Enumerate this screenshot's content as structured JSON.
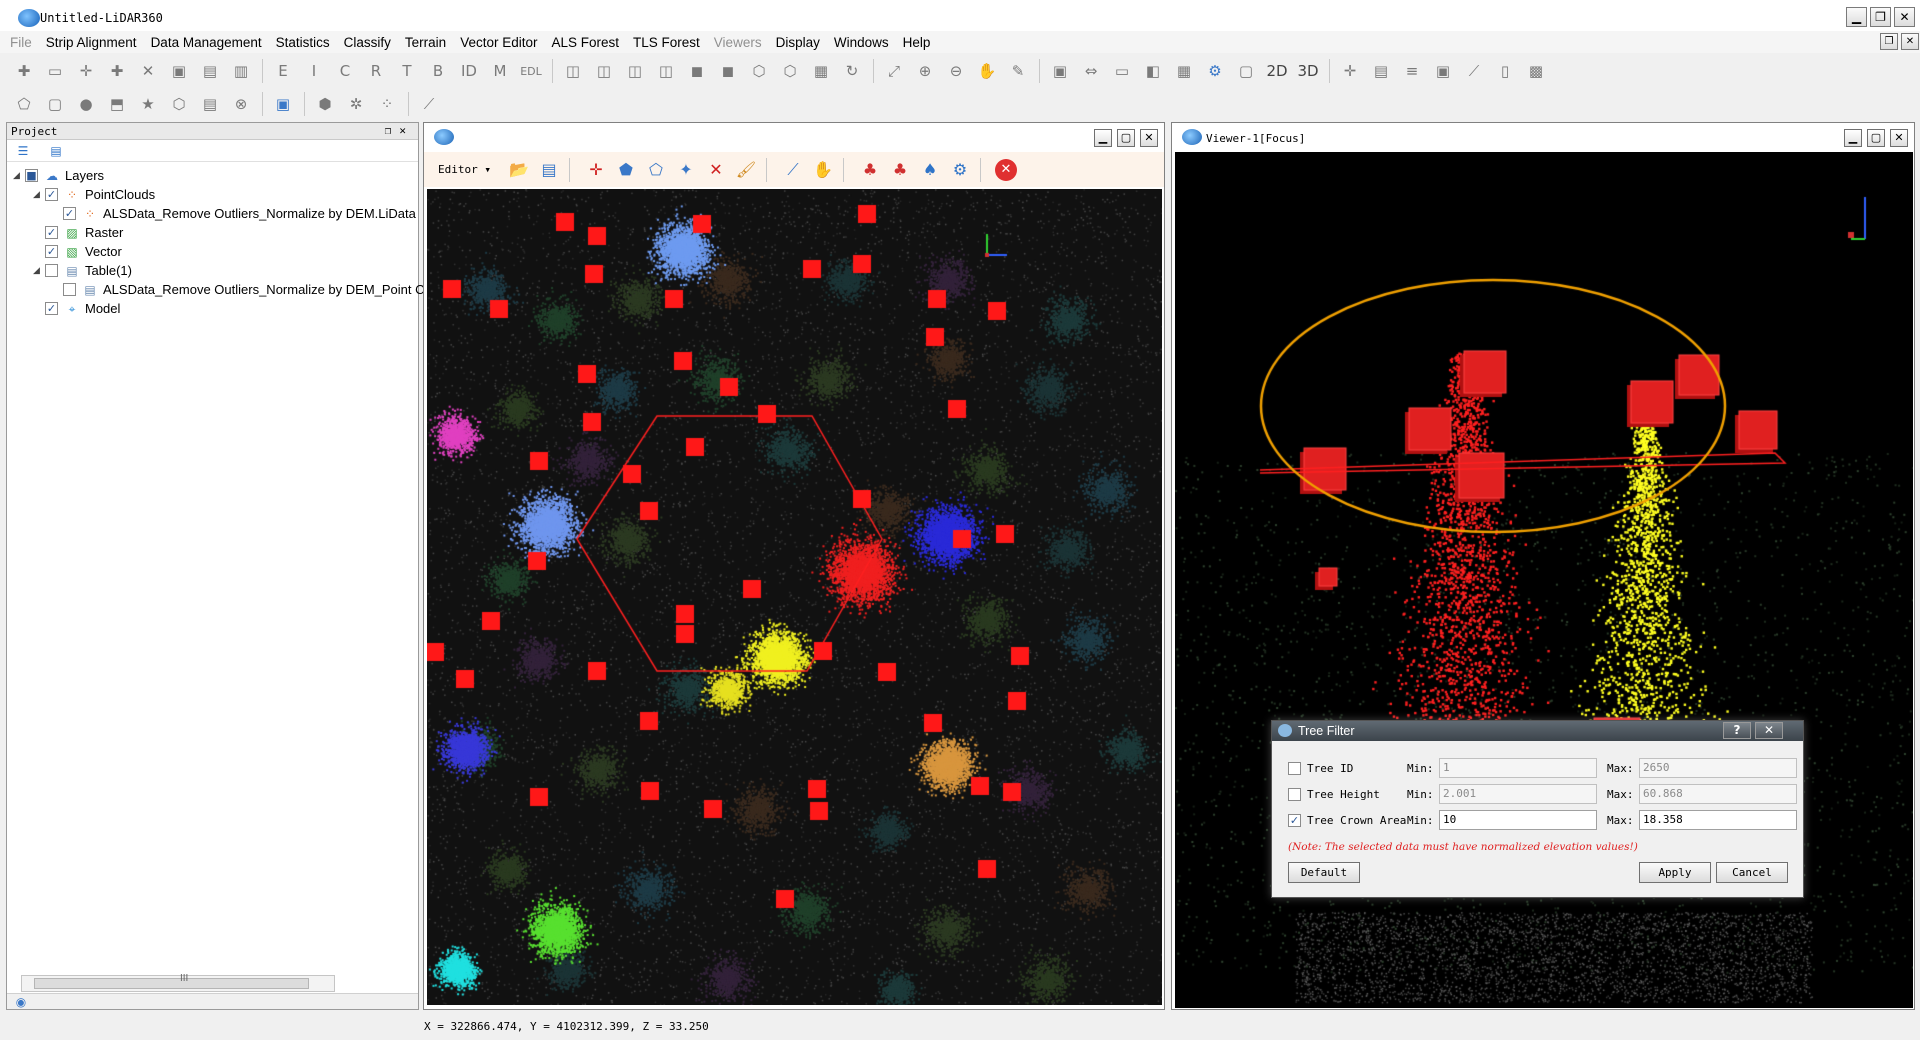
{
  "window": {
    "title": "Untitled-LiDAR360"
  },
  "menu": {
    "items": [
      {
        "label": "File",
        "disabled": false
      },
      {
        "label": "Strip Alignment",
        "disabled": false
      },
      {
        "label": "Data Management",
        "disabled": false
      },
      {
        "label": "Statistics",
        "disabled": false
      },
      {
        "label": "Classify",
        "disabled": false
      },
      {
        "label": "Terrain",
        "disabled": false
      },
      {
        "label": "Vector Editor",
        "disabled": false
      },
      {
        "label": "ALS Forest",
        "disabled": false
      },
      {
        "label": "TLS Forest",
        "disabled": false
      },
      {
        "label": "Viewers",
        "disabled": true
      },
      {
        "label": "Display",
        "disabled": false
      },
      {
        "label": "Windows",
        "disabled": false
      },
      {
        "label": "Help",
        "disabled": false
      }
    ]
  },
  "toolbar": {
    "text_buttons": {
      "d2": "2D",
      "d3": "3D"
    }
  },
  "project": {
    "title": "Project",
    "tree": {
      "layers": "Layers",
      "pointclouds": "PointClouds",
      "pointcloud_file": "ALSData_Remove Outliers_Normalize by DEM.LiData",
      "raster": "Raster",
      "vector": "Vector",
      "table": "Table(1)",
      "table_file": "ALSData_Remove Outliers_Normalize by DEM_Point Cloud Segmentation",
      "model": "Model"
    },
    "scroll_grip": "III"
  },
  "viewer2d": {
    "editor_label": "Editor"
  },
  "viewer3d": {
    "title": "Viewer-1[Focus]"
  },
  "status": {
    "coords": "X = 322866.474, Y = 4102312.399, Z = 33.250"
  },
  "tree_filter": {
    "title": "Tree Filter",
    "rows": [
      {
        "label": "Tree ID",
        "checked": false,
        "min": "1",
        "max": "2650"
      },
      {
        "label": "Tree Height",
        "checked": false,
        "min": "2.001",
        "max": "60.868"
      },
      {
        "label": "Tree Crown Area",
        "checked": true,
        "min": "10",
        "max": "18.358"
      }
    ],
    "min_label": "Min:",
    "max_label": "Max:",
    "note": "(Note: The selected data must have normalized elevation values!)",
    "default_button": "Default",
    "apply_button": "Apply",
    "cancel_button": "Cancel"
  },
  "colors": {
    "selection": "#ff2020",
    "highlight_ellipse": "#f0a000",
    "seed": "#ff1818"
  }
}
